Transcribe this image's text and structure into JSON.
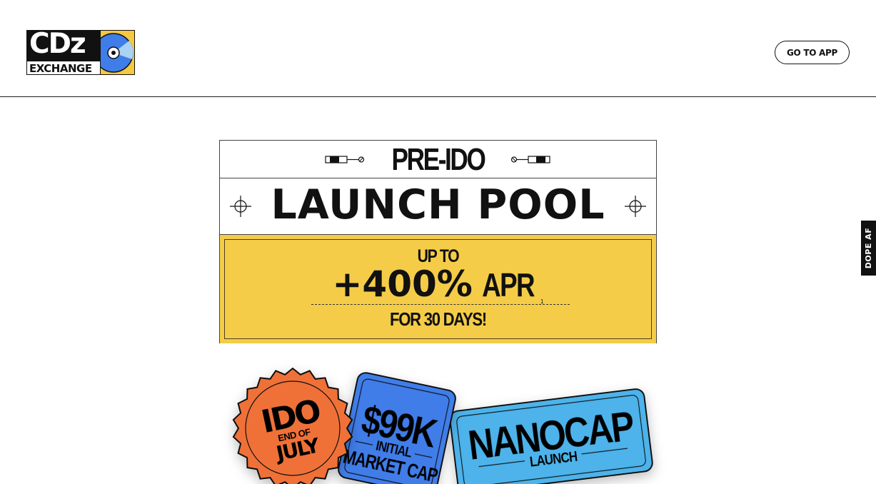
{
  "header": {
    "logo": {
      "line1": "CDz",
      "line2": "EXCHANGE",
      "icon": "disc-icon"
    },
    "cta_label": "GO TO APP"
  },
  "side_tab": {
    "label": "DOPE AF"
  },
  "card": {
    "pre_title": "PRE-IDO",
    "title": "LAUNCH POOL",
    "up_to": "UP TO",
    "percent": "+400%",
    "apr": "APR",
    "apr_footnote": "1",
    "duration": "FOR 30 DAYS!"
  },
  "badges": [
    {
      "line1": "IDO",
      "line2": "END OF",
      "line3": "JULY",
      "color": "#ef7138"
    },
    {
      "line1": "$99K",
      "line2": "INITIAL",
      "line3": "MARKET CAP",
      "color": "#3f7de8"
    },
    {
      "line1": "NANOCAP",
      "line2": "LAUNCH",
      "color": "#4db3ea"
    }
  ],
  "colors": {
    "yellow": "#f5cc47",
    "orange": "#ef7138",
    "blue": "#3f7de8",
    "light_blue": "#4db3ea"
  }
}
